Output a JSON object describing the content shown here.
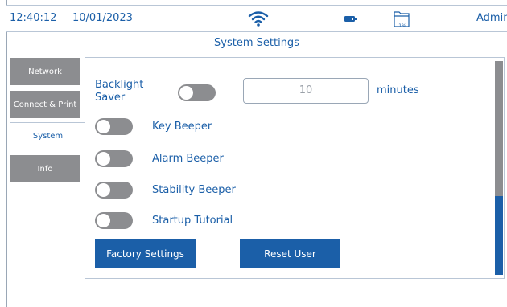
{
  "statusbar": {
    "time": "12:40:12",
    "date": "10/01/2023",
    "storage_percent": "1%",
    "user": "Admin",
    "wifi_icon": "wifi-icon",
    "battery_icon": "battery-icon",
    "storage_icon": "folder-icon"
  },
  "page": {
    "title": "System Settings"
  },
  "tabs": [
    {
      "label": "Network",
      "active": false
    },
    {
      "label": "Connect & Print",
      "active": false
    },
    {
      "label": "System",
      "active": true
    },
    {
      "label": "Info",
      "active": false
    }
  ],
  "settings": {
    "backlight_saver": {
      "label_line1": "Backlight",
      "label_line2": "Saver",
      "enabled": false,
      "value": "10",
      "unit": "minutes"
    },
    "key_beeper": {
      "label": "Key Beeper",
      "enabled": false
    },
    "alarm_beeper": {
      "label": "Alarm Beeper",
      "enabled": false
    },
    "stability_beeper": {
      "label": "Stability Beeper",
      "enabled": false
    },
    "startup_tutorial": {
      "label": "Startup Tutorial",
      "enabled": false
    }
  },
  "buttons": {
    "factory_settings": "Factory Settings",
    "reset_user": "Reset User"
  },
  "colors": {
    "accent": "#1b5fa8",
    "toggle_off": "#8c8d90",
    "border": "#b9c6d6"
  }
}
